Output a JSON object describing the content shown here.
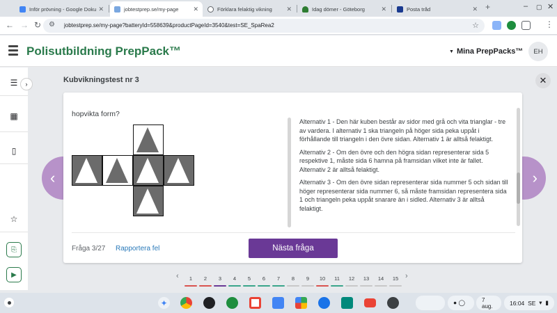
{
  "browser": {
    "tabs": [
      {
        "title": "Inför prövning - Google Doku",
        "color": "#4285f4",
        "active": false
      },
      {
        "title": "jobtestprep.se/my-page",
        "color": "#7aa7e0",
        "active": true
      },
      {
        "title": "Förklara felaktig vikning",
        "color": "#5f6368",
        "active": false
      },
      {
        "title": "Idag dömer - Göteborg",
        "color": "#2e7d32",
        "active": false
      },
      {
        "title": "Posta tråd",
        "color": "#1a3a8f",
        "active": false
      }
    ],
    "new_tab": "+",
    "url": "jobtestprep.se/my-page?batteryId=558639&productPageId=3540&test=SE_SpaRea2"
  },
  "header": {
    "brand": "Polisutbildning PrepPack™",
    "my_packs": "Mina PrepPacks™",
    "avatar_initials": "EH"
  },
  "test": {
    "title": "Kubvikningstest nr 3",
    "question_text": "hopvikta form?",
    "explanation": [
      "Alternativ 1 - Den här kuben består av sidor med grå och vita trianglar - tre av vardera. I alternativ 1 ska triangeln på höger sida peka uppåt i förhållande till triangeln i den övre sidan. Alternativ 1 är alltså felaktigt.",
      "Alternativ 2 - Om den övre och den högra sidan representerar sida 5 respektive 1, måste sida 6 hamna på framsidan vilket inte är fallet. Alternativ 2 är alltså felaktigt.",
      "Alternativ 3 - Om den övre sidan representerar sida nummer 5 och sidan till höger representerar sida nummer 6, så måste framsidan representera sida 1 och triangeln peka uppåt snarare än i sidled. Alternativ 3 är alltså felaktigt."
    ],
    "question_counter": "Fråga 3/27",
    "report_link": "Rapportera fel",
    "next_button": "Nästa fråga"
  },
  "pager": {
    "pages": [
      {
        "label": "1",
        "color": "#d9534f"
      },
      {
        "label": "2",
        "color": "#d9534f"
      },
      {
        "label": "3",
        "color": "#6a3996"
      },
      {
        "label": "4",
        "color": "#3aa58a"
      },
      {
        "label": "5",
        "color": "#3aa58a"
      },
      {
        "label": "6",
        "color": "#3aa58a"
      },
      {
        "label": "7",
        "color": "#3aa58a"
      },
      {
        "label": "8",
        "color": "#c8c8c8"
      },
      {
        "label": "9",
        "color": "#c8c8c8"
      },
      {
        "label": "10",
        "color": "#d9534f"
      },
      {
        "label": "11",
        "color": "#3aa58a"
      },
      {
        "label": "12",
        "color": "#c8c8c8"
      },
      {
        "label": "13",
        "color": "#c8c8c8"
      },
      {
        "label": "14",
        "color": "#c8c8c8"
      },
      {
        "label": "15",
        "color": "#c8c8c8"
      }
    ]
  },
  "taskbar": {
    "apps": [
      "gemini-icon",
      "chrome-icon",
      "podcast-icon",
      "photos-icon",
      "gmail-icon",
      "files-icon",
      "play-store-icon",
      "messages-icon",
      "meet-icon",
      "youtube-icon",
      "camera-icon"
    ],
    "date": "7 aug.",
    "time": "16:04",
    "region": "SE"
  },
  "colors": {
    "brand_green": "#2a7a4b",
    "accent_purple": "#6a3996",
    "nav_arrow": "#b792c9",
    "link_blue": "#2979b9"
  }
}
